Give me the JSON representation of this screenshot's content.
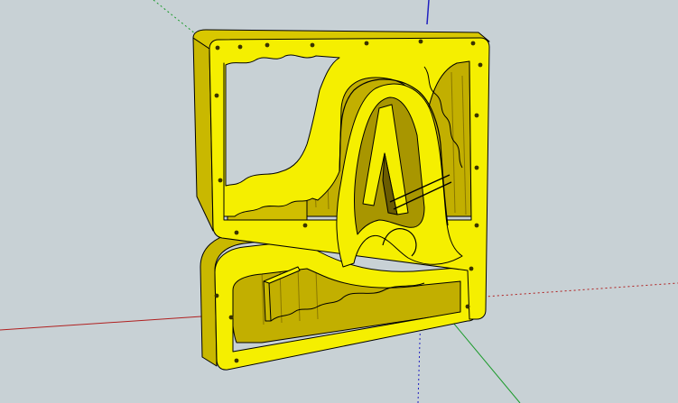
{
  "app": {
    "viewport_background": "#c8d1d5"
  },
  "model": {
    "face_color": "#f5ef00",
    "side_color": "#c9b800",
    "dark_side_color": "#8a7800",
    "edge_color": "#000000",
    "screw_hole_count": 20
  },
  "axes": {
    "red": "#b02020",
    "green": "#1a9a2a",
    "blue": "#2020c0"
  }
}
